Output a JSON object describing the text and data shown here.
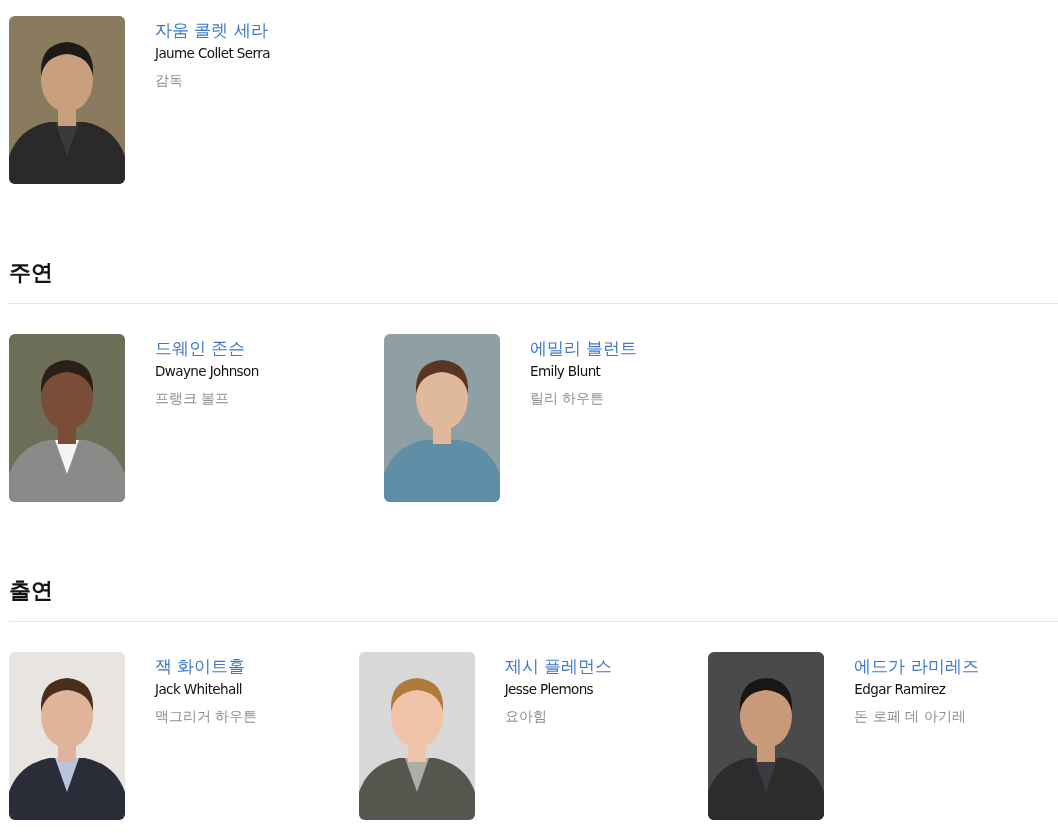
{
  "sections": [
    {
      "people": [
        {
          "name_ko": "자움 콜렛 세라",
          "name_en": "Jaume Collet Serra",
          "role": "감독"
        }
      ]
    },
    {
      "title": "주연",
      "people": [
        {
          "name_ko": "드웨인 존슨",
          "name_en": "Dwayne Johnson",
          "role": "프랭크 볼프"
        },
        {
          "name_ko": "에밀리 블런트",
          "name_en": "Emily Blunt",
          "role": "릴리 하우튼"
        }
      ]
    },
    {
      "title": "출연",
      "people": [
        {
          "name_ko": "잭 화이트홀",
          "name_en": "Jack Whitehall",
          "role": "맥그리거 하우튼"
        },
        {
          "name_ko": "제시 플레먼스",
          "name_en": "Jesse Plemons",
          "role": "요아힘"
        },
        {
          "name_ko": "에드가 라미레즈",
          "name_en": "Edgar Ramirez",
          "role": "돈 로페 데 아기레"
        }
      ]
    }
  ]
}
